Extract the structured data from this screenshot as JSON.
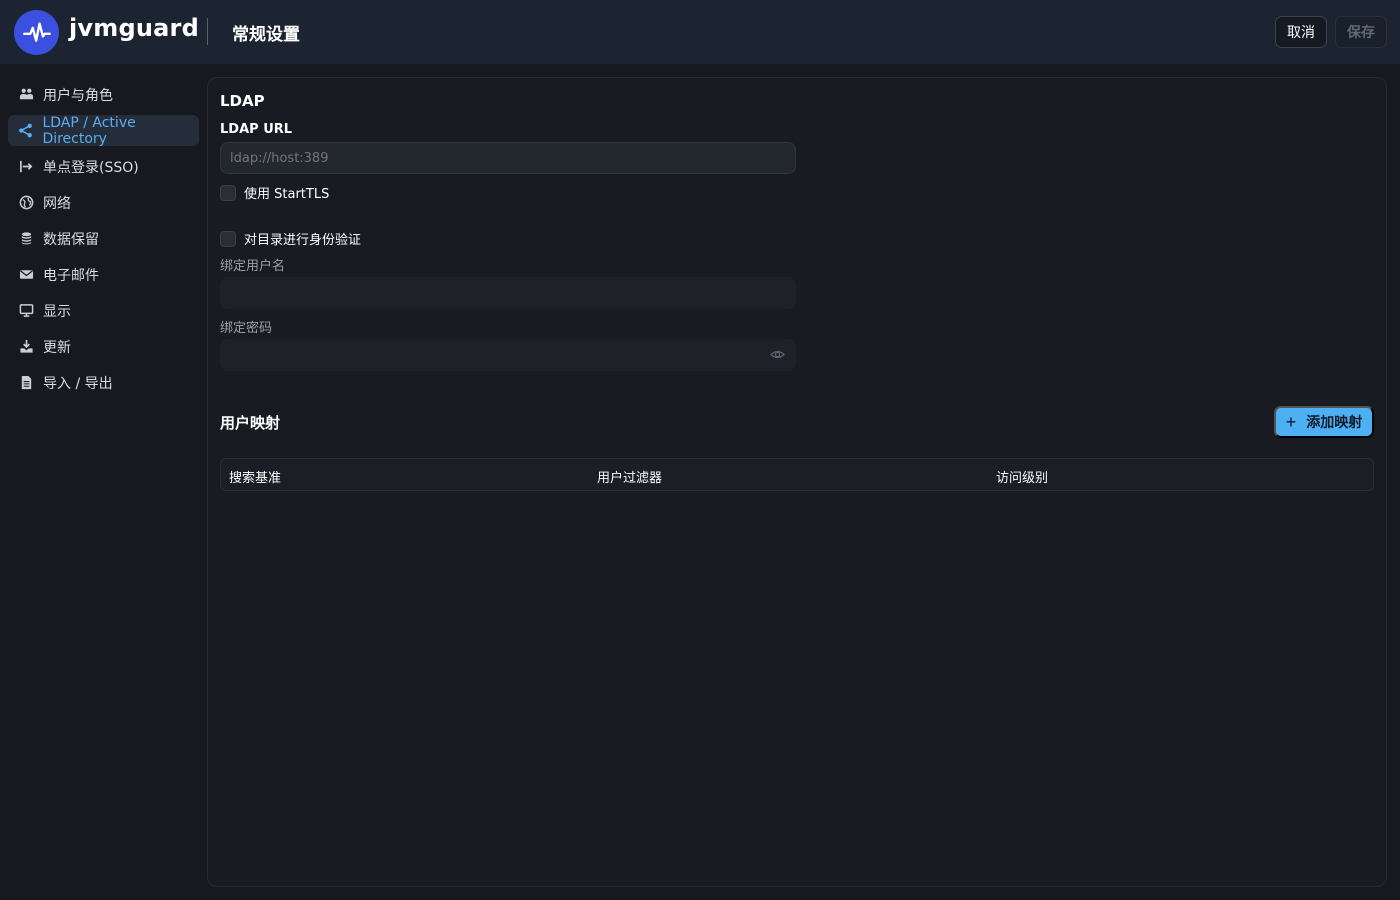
{
  "header": {
    "brand": "jvmguard",
    "page_title": "常规设置",
    "cancel_label": "取消",
    "save_label": "保存",
    "logo_icon": "pulse-icon",
    "logo_color": "#3b4fe0"
  },
  "sidebar": {
    "items": [
      {
        "label": "用户与角色",
        "icon": "users-icon",
        "active": false
      },
      {
        "label": "LDAP / Active Directory",
        "icon": "share-nodes-icon",
        "active": true
      },
      {
        "label": "单点登录(SSO)",
        "icon": "sign-in-icon",
        "active": false
      },
      {
        "label": "网络",
        "icon": "globe-icon",
        "active": false
      },
      {
        "label": "数据保留",
        "icon": "database-icon",
        "active": false
      },
      {
        "label": "电子邮件",
        "icon": "envelope-icon",
        "active": false
      },
      {
        "label": "显示",
        "icon": "monitor-icon",
        "active": false
      },
      {
        "label": "更新",
        "icon": "download-icon",
        "active": false
      },
      {
        "label": "导入 / 导出",
        "icon": "file-icon",
        "active": false
      }
    ]
  },
  "ldap": {
    "section_title": "LDAP",
    "url_label": "LDAP URL",
    "url_placeholder": "ldap://host:389",
    "url_value": "",
    "starttls_label": "使用 StartTLS",
    "starttls_checked": false,
    "auth_label": "对目录进行身份验证",
    "auth_checked": false,
    "bind_user_label": "绑定用户名",
    "bind_user_value": "",
    "bind_password_label": "绑定密码",
    "bind_password_value": ""
  },
  "mapping": {
    "title": "用户映射",
    "add_label": "添加映射",
    "columns": [
      "搜索基准",
      "用户过滤器",
      "访问级别"
    ],
    "rows": []
  },
  "colors": {
    "accent": "#4db0f2",
    "active_nav_text": "#5aaef0",
    "background": "#17191e",
    "topbar": "#1c2431"
  }
}
